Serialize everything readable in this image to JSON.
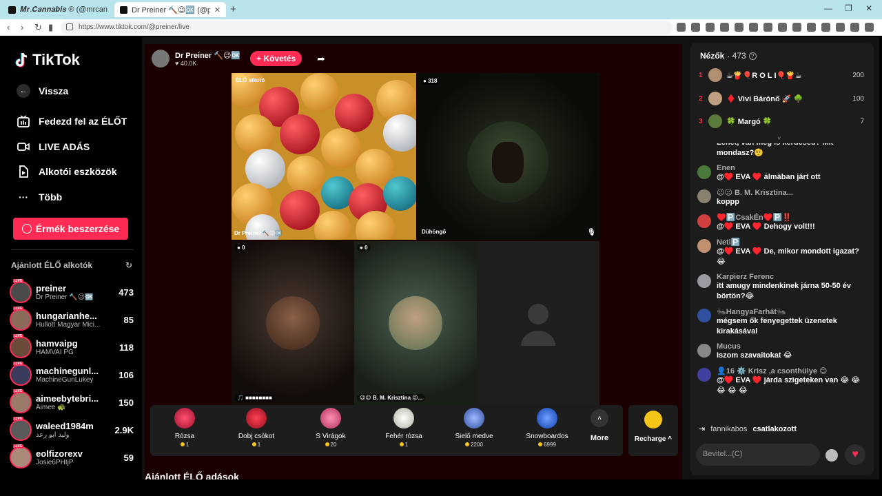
{
  "browser": {
    "tab_inactive": "𝑴𝒓.𝑪𝒂𝒏𝒏𝒂𝒃𝒊𝒔 ® (@mrcannabis",
    "tab_active": "Dr Preiner 🔨😉🆗 (@preiner",
    "url": "https://www.tiktok.com/@preiner/live"
  },
  "sidebar": {
    "logo": "TikTok",
    "back": "Vissza",
    "nav": [
      {
        "label": "Fedezd fel az ÉLŐT",
        "icon": "tv-icon"
      },
      {
        "label": "LIVE ADÁS",
        "icon": "camera-icon"
      },
      {
        "label": "Alkotói eszközök",
        "icon": "creator-tools-icon"
      },
      {
        "label": "Több",
        "icon": "more-icon"
      }
    ],
    "coins_button": "Érmék beszerzése",
    "recommended_heading": "Ajánlott ÉLŐ alkotók",
    "recommended": [
      {
        "name": "preiner",
        "sub": "Dr Preiner 🔨😉🆗",
        "count": "473"
      },
      {
        "name": "hungarianhe...",
        "sub": "Hullott Magyar Mici...",
        "count": "85"
      },
      {
        "name": "hamvaipg",
        "sub": "HAMVAI PG",
        "count": "118"
      },
      {
        "name": "machinegunl...",
        "sub": "MachineGunLukey",
        "count": "106"
      },
      {
        "name": "aimeebytebri...",
        "sub": "Aimee 🐢",
        "count": "150"
      },
      {
        "name": "waleed1984m",
        "sub": "وليد ابو رعد",
        "count": "2.9K"
      },
      {
        "name": "eolfizorexv",
        "sub": "Josie6PHIjP",
        "count": "59"
      }
    ]
  },
  "host": {
    "name": "Dr Preiner 🔨😉🆗",
    "likes": "40.0K",
    "follow": "+ Követés"
  },
  "tiles": {
    "main_label": "ÉLŐ alkotó",
    "main_bottom": "Dr Preiner 🔨😉🆗",
    "guest1_count": "318",
    "guest1_label": "Dühöngő",
    "guest2_count": "0",
    "guest2_label": "🎵 ■■■■■■■■",
    "guest3_count": "0",
    "guest3_label": "😉😉 B. M. Krisztina 😉..."
  },
  "gifts": [
    {
      "name": "Rózsa",
      "price": "1",
      "color": "#e0304a",
      "icon": "rose-icon"
    },
    {
      "name": "Dobj csókot",
      "price": "1",
      "color": "#e03040",
      "icon": "lips-icon"
    },
    {
      "name": "S Virágok",
      "price": "20",
      "color": "#e07090",
      "icon": "flowers-icon"
    },
    {
      "name": "Fehér rózsa",
      "price": "1",
      "color": "#eeeeee",
      "icon": "white-rose-icon"
    },
    {
      "name": "Sielő medve",
      "price": "2200",
      "color": "#6080d0",
      "icon": "ski-bear-icon"
    },
    {
      "name": "Snowboardos",
      "price": "6999",
      "color": "#3070e0",
      "icon": "snowboarder-icon"
    }
  ],
  "more": "More",
  "recharge": "Recharge ^",
  "recommended_live": "Ajánlott ÉLŐ adások",
  "viewers": {
    "title": "Nézők",
    "count": "· 473",
    "top": [
      {
        "rank": "1",
        "name": "☕🍟🎈R O L I🎈🍟☕",
        "score": "200"
      },
      {
        "rank": "2",
        "name": "♦️ Vivi Bárónő 🚀 🌳",
        "score": "100"
      },
      {
        "rank": "3",
        "name": "🍀 Margó 🍀",
        "score": "7"
      }
    ]
  },
  "chat": [
    {
      "user": "",
      "text": "Lehet, van még is kérdésed? Mit mondasz?🤨"
    },
    {
      "user": "Enen",
      "text": "@♥️ EVA ♥️ álmàban járt ott"
    },
    {
      "user": "😉😉 B. M. Krisztina...",
      "text": "koppp"
    },
    {
      "user": "♥️🅿️CsakÉn♥️🅿️‼️",
      "text": "@♥️ EVA ♥️ Dehogy volt!!!"
    },
    {
      "user": "Neti🅿️",
      "text": "@♥️ EVA ♥️ De, mikor mondott igazat? 😂"
    },
    {
      "user": "Karpierz Ferenc",
      "text": "itt amugy mindenkinek járna 50-50 év börtön?😂"
    },
    {
      "user": "🐜HangyaFarhát🐜",
      "text": "mégsem ők fenyegettek üzenetek kirakásával"
    },
    {
      "user": "Mucus",
      "text": "Iszom szavaitokat 😂"
    },
    {
      "user": "👤16 ⚙️ Krisz ,a csonthülye 😊",
      "text": "@♥️ EVA ♥️ járda szigeteken van 😂 😂 😂 😂 😂"
    }
  ],
  "join": {
    "user": "fannikabos",
    "text": "csatlakozott"
  },
  "input_placeholder": "Bevitel...(C)"
}
